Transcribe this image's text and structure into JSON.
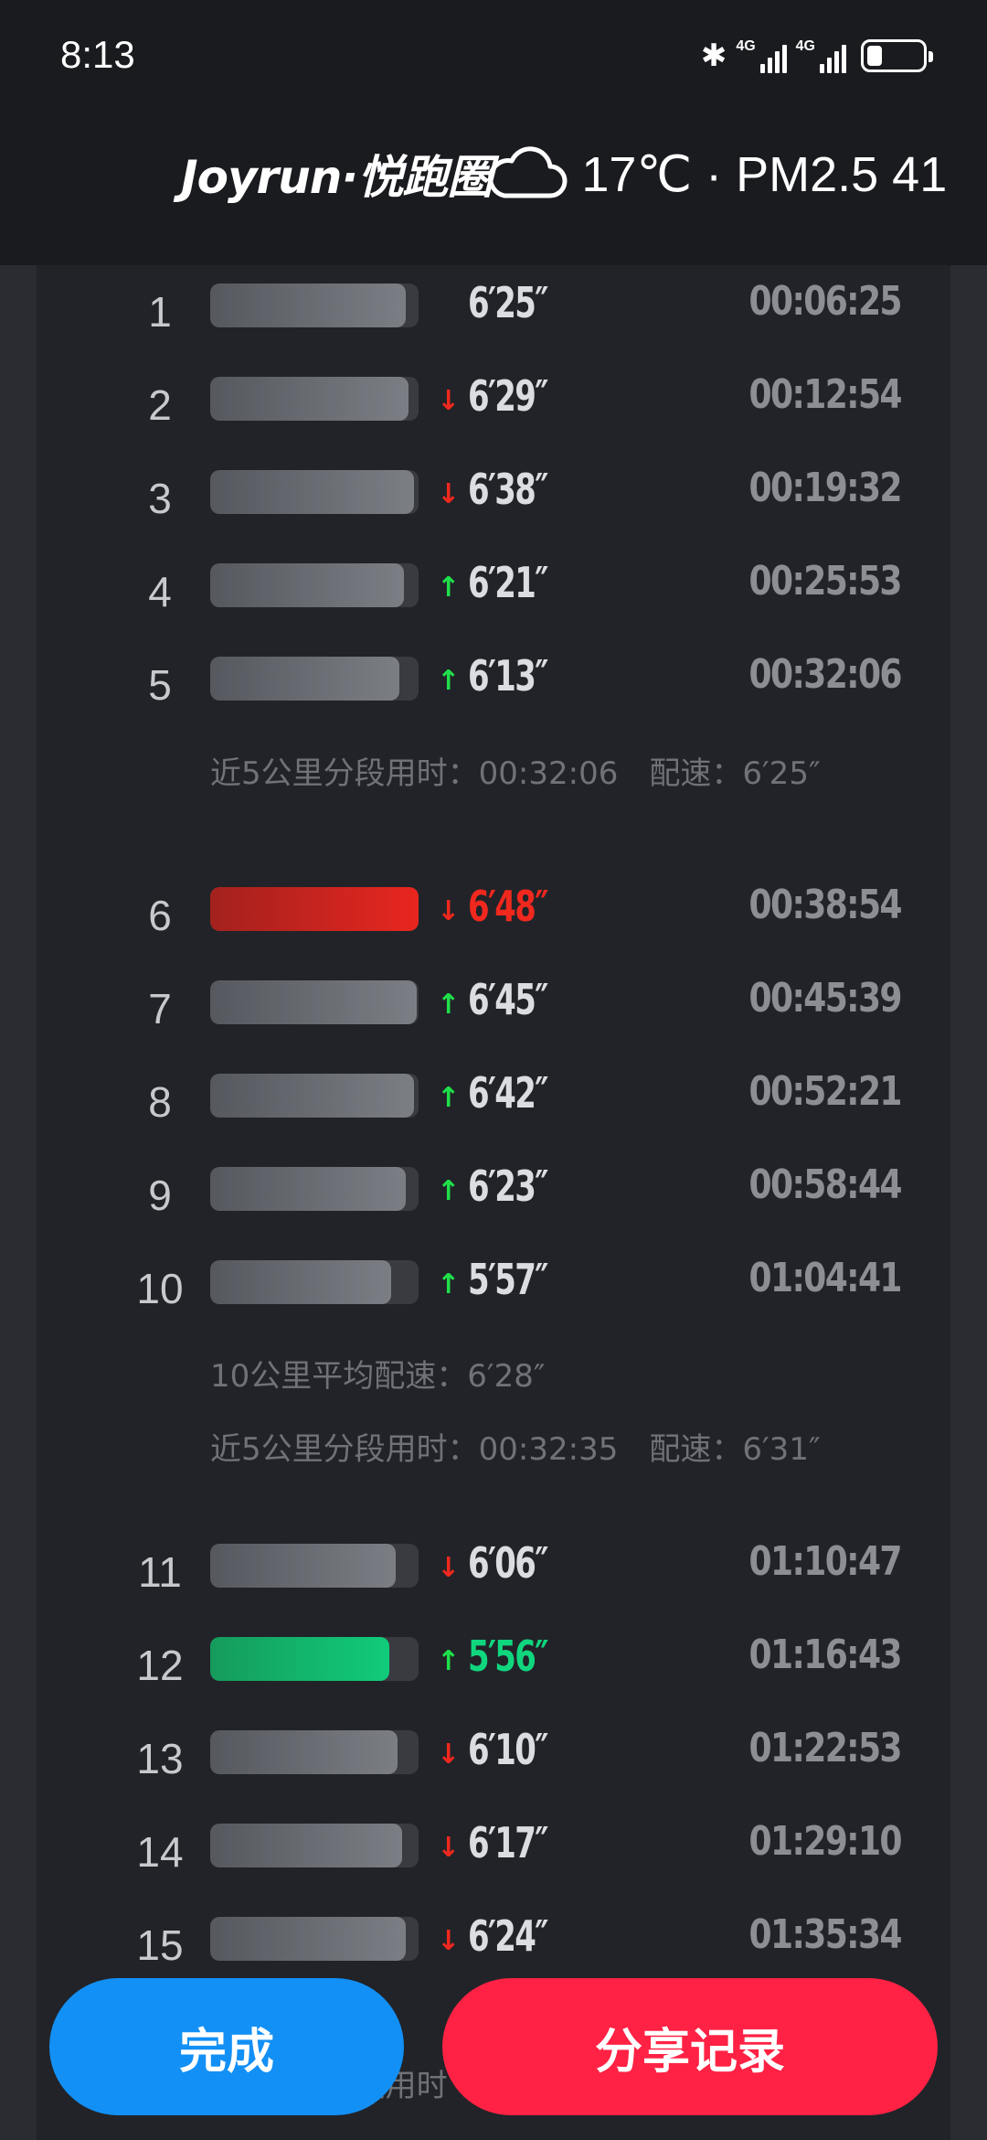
{
  "status_bar": {
    "time": "8:13",
    "icons": [
      "bluetooth-icon",
      "signal-4g-icon",
      "signal-4g-icon",
      "battery-icon"
    ],
    "network_label_1": "4G",
    "network_label_2": "4G"
  },
  "header": {
    "brand": "Joyrun·悦跑圈",
    "weather_icon": "cloud-icon",
    "weather": "17℃ · PM2.5 41"
  },
  "colors": {
    "slow_red": "#f0281e",
    "fast_green": "#10d67e",
    "up_arrow": "#1fe04a",
    "done_button": "#1390f5",
    "share_button": "#ff2244"
  },
  "splits": [
    {
      "km": "1",
      "pace": "6′25″",
      "cumulative": "00:06:25",
      "trend": "",
      "bar": 0.94,
      "style": "normal"
    },
    {
      "km": "2",
      "pace": "6′29″",
      "cumulative": "00:12:54",
      "trend": "down",
      "bar": 0.95,
      "style": "normal"
    },
    {
      "km": "3",
      "pace": "6′38″",
      "cumulative": "00:19:32",
      "trend": "down",
      "bar": 0.98,
      "style": "normal"
    },
    {
      "km": "4",
      "pace": "6′21″",
      "cumulative": "00:25:53",
      "trend": "up",
      "bar": 0.93,
      "style": "normal"
    },
    {
      "km": "5",
      "pace": "6′13″",
      "cumulative": "00:32:06",
      "trend": "up",
      "bar": 0.91,
      "style": "normal"
    },
    {
      "km": "6",
      "pace": "6′48″",
      "cumulative": "00:38:54",
      "trend": "down",
      "bar": 1.0,
      "style": "red"
    },
    {
      "km": "7",
      "pace": "6′45″",
      "cumulative": "00:45:39",
      "trend": "up",
      "bar": 0.99,
      "style": "normal"
    },
    {
      "km": "8",
      "pace": "6′42″",
      "cumulative": "00:52:21",
      "trend": "up",
      "bar": 0.98,
      "style": "normal"
    },
    {
      "km": "9",
      "pace": "6′23″",
      "cumulative": "00:58:44",
      "trend": "up",
      "bar": 0.94,
      "style": "normal"
    },
    {
      "km": "10",
      "pace": "5′57″",
      "cumulative": "01:04:41",
      "trend": "up",
      "bar": 0.87,
      "style": "normal"
    },
    {
      "km": "11",
      "pace": "6′06″",
      "cumulative": "01:10:47",
      "trend": "down",
      "bar": 0.89,
      "style": "normal"
    },
    {
      "km": "12",
      "pace": "5′56″",
      "cumulative": "01:16:43",
      "trend": "up",
      "bar": 0.86,
      "style": "green"
    },
    {
      "km": "13",
      "pace": "6′10″",
      "cumulative": "01:22:53",
      "trend": "down",
      "bar": 0.9,
      "style": "normal"
    },
    {
      "km": "14",
      "pace": "6′17″",
      "cumulative": "01:29:10",
      "trend": "down",
      "bar": 0.92,
      "style": "normal"
    },
    {
      "km": "15",
      "pace": "6′24″",
      "cumulative": "01:35:34",
      "trend": "down",
      "bar": 0.94,
      "style": "normal"
    }
  ],
  "summaries": {
    "first5": "近5公里分段用时：00:32:06　配速：6′25″",
    "avg10": "10公里平均配速：6′28″",
    "second5": "近5公里分段用时：00:32:35　配速：6′31″",
    "third5_partial": "近5公里分段用时"
  },
  "buttons": {
    "done": "完成",
    "share": "分享记录"
  }
}
